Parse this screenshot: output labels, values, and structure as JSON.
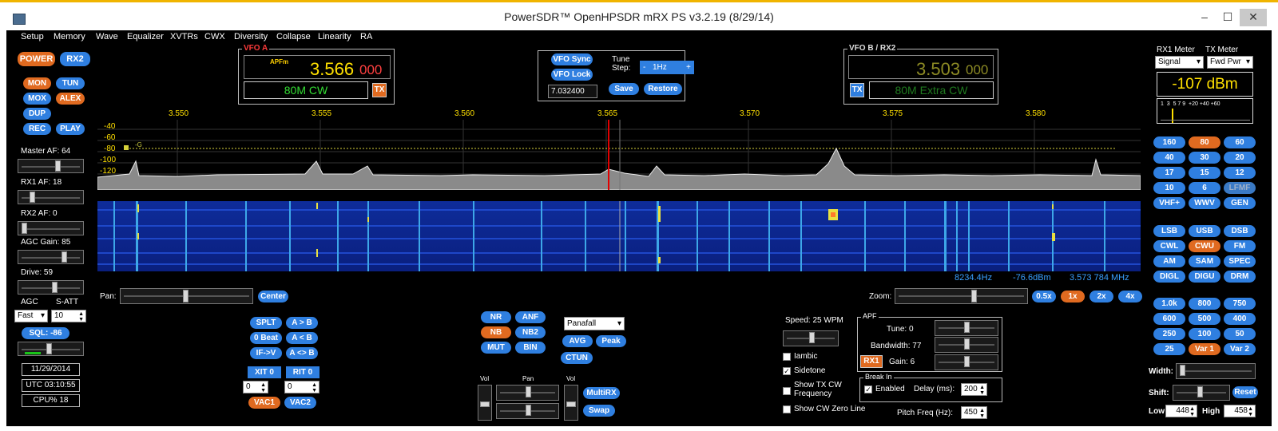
{
  "window": {
    "title": "PowerSDR™ OpenHPSDR mRX PS v3.2.19 (8/29/14)",
    "min": "–",
    "max": "☐",
    "close": "✕"
  },
  "menu": [
    "Setup",
    "Memory",
    "Wave",
    "Equalizer",
    "XVTRs",
    "CWX",
    "Diversity",
    "Collapse",
    "Linearity",
    "RA"
  ],
  "left": {
    "power": "POWER",
    "rx2": "RX2",
    "mon": "MON",
    "tun": "TUN",
    "mox": "MOX",
    "alex": "ALEX",
    "dup": "DUP",
    "rec": "REC",
    "play": "PLAY",
    "master_af": "Master AF:  64",
    "rx1_af": "RX1 AF:  18",
    "rx2_af": "RX2 AF:  0",
    "agc_gain": "AGC Gain:  85",
    "drive": "Drive:  59",
    "agc": "AGC",
    "satt": "S-ATT",
    "agc_mode": "Fast",
    "satt_value": "10",
    "sql": "SQL: -86",
    "date": "11/29/2014",
    "utc": "UTC 03:10:55",
    "cpu": "CPU%  18"
  },
  "vfoa": {
    "title": "VFO A",
    "mode_tag": "APFm",
    "freq_main": "3.566",
    "freq_sub": "000",
    "band": "80M CW",
    "tx": "TX"
  },
  "vfocenter": {
    "sync": "VFO Sync",
    "lock": "VFO Lock",
    "tune_step_label": "Tune\nStep:",
    "tune_step": "1Hz",
    "minus": "-",
    "plus": "+",
    "freq_entry": "7.032400",
    "save": "Save",
    "restore": "Restore"
  },
  "vfob": {
    "title": "VFO B / RX2",
    "freq_main": "3.503",
    "freq_sub": "000",
    "band": "80M Extra CW",
    "tx": "TX"
  },
  "spectrum": {
    "freq_ticks": [
      "3.550",
      "3.555",
      "3.560",
      "3.565",
      "3.570",
      "3.575",
      "3.580"
    ],
    "db_ticks": [
      "-40",
      "-60",
      "-80",
      "-100",
      "-120"
    ],
    "marker": "-G",
    "readout_hz": "8234.4Hz",
    "readout_dbm": "-76.6dBm",
    "readout_mhz": "3.573 784 MHz"
  },
  "pan": {
    "label": "Pan:",
    "center": "Center"
  },
  "zoom": {
    "label": "Zoom:",
    "buttons": [
      "0.5x",
      "1x",
      "2x",
      "4x"
    ]
  },
  "controls": {
    "splt": "SPLT",
    "atob": "A > B",
    "zerobeat": "0 Beat",
    "altb": "A < B",
    "ifv": "IF->V",
    "aswap": "A <> B",
    "xit": "XIT  0",
    "rit": "RIT  0",
    "xit_val": "0",
    "rit_val": "0",
    "vac1": "VAC1",
    "vac2": "VAC2",
    "nr": "NR",
    "anf": "ANF",
    "nb": "NB",
    "nb2": "NB2",
    "mut": "MUT",
    "bin": "BIN",
    "display_mode": "Panafall",
    "avg": "AVG",
    "peak": "Peak",
    "ctun": "CTUN",
    "vol1": "Vol",
    "pan2": "Pan",
    "vol2": "Vol",
    "multirx": "MultiRX",
    "swap": "Swap"
  },
  "cw": {
    "speed": "Speed:  25 WPM",
    "iambic": "Iambic",
    "sidetone": "Sidetone",
    "show_tx": "Show TX CW\nFrequency",
    "show_zero": "Show CW Zero Line",
    "apf_title": "APF",
    "tune": "Tune:  0",
    "bandwidth": "Bandwidth:  77",
    "rx1": "RX1",
    "gain": "Gain:  6",
    "breakin_title": "Break In",
    "enabled": "Enabled",
    "delay": "Delay (ms):",
    "delay_value": "200",
    "pitch": "Pitch Freq (Hz):",
    "pitch_value": "450"
  },
  "meter": {
    "rx1_label": "RX1 Meter",
    "tx_label": "TX Meter",
    "rx1_sel": "Signal",
    "tx_sel": "Fwd Pwr",
    "reading": "-107 dBm",
    "scale": "1  3  5 7 9  +20 +40 +60"
  },
  "bands": [
    "160",
    "80",
    "60",
    "40",
    "30",
    "20",
    "17",
    "15",
    "12",
    "10",
    "6",
    "LFMF",
    "VHF+",
    "WWV",
    "GEN"
  ],
  "modes": [
    "LSB",
    "USB",
    "DSB",
    "CWL",
    "CWU",
    "FM",
    "AM",
    "SAM",
    "SPEC",
    "DIGL",
    "DIGU",
    "DRM"
  ],
  "filters": [
    "1.0k",
    "800",
    "750",
    "600",
    "500",
    "400",
    "250",
    "100",
    "50",
    "25",
    "Var 1",
    "Var 2"
  ],
  "filter_ctrl": {
    "width": "Width:",
    "shift": "Shift:",
    "reset": "Reset",
    "low": "Low",
    "low_value": "448",
    "high": "High",
    "high_value": "458"
  },
  "colors": {
    "accent_blue": "#2f7fe0",
    "active_orange": "#e06a20",
    "vfo_yellow": "#ffe000",
    "band_green": "#33dd33"
  }
}
